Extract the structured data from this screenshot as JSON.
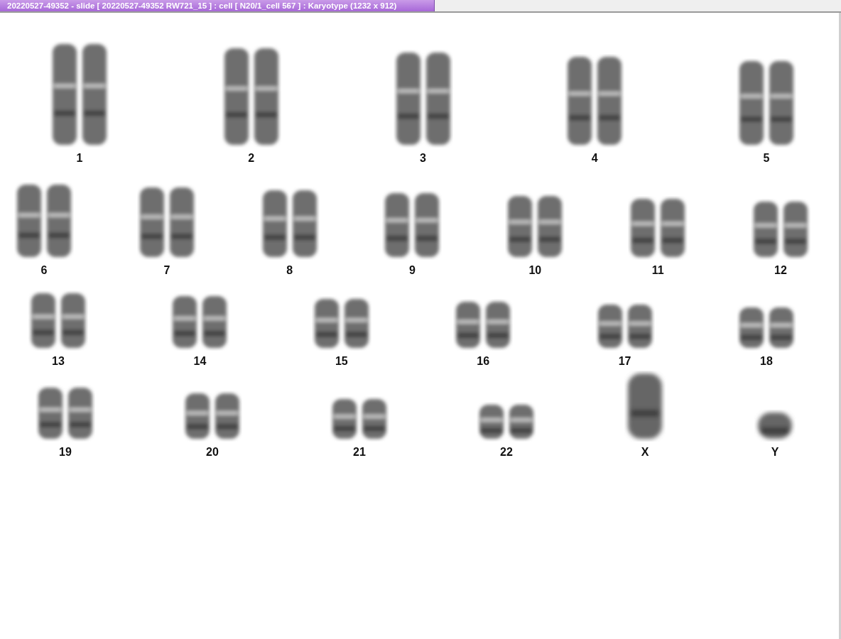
{
  "window": {
    "title": "20220527-49352 - slide [ 20220527-49352 RW721_15 ] : cell [ N20/1_cell 567 ] : Karyotype  (1232 x 912)"
  },
  "karyotype": {
    "rows": [
      [
        {
          "label": "1",
          "kind": "pair"
        },
        {
          "label": "2",
          "kind": "pair"
        },
        {
          "label": "3",
          "kind": "pair"
        },
        {
          "label": "4",
          "kind": "pair"
        },
        {
          "label": "5",
          "kind": "pair"
        }
      ],
      [
        {
          "label": "6",
          "kind": "pair"
        },
        {
          "label": "7",
          "kind": "pair"
        },
        {
          "label": "8",
          "kind": "pair"
        },
        {
          "label": "9",
          "kind": "pair"
        },
        {
          "label": "10",
          "kind": "pair"
        },
        {
          "label": "11",
          "kind": "pair"
        },
        {
          "label": "12",
          "kind": "pair"
        }
      ],
      [
        {
          "label": "13",
          "kind": "pair"
        },
        {
          "label": "14",
          "kind": "pair"
        },
        {
          "label": "15",
          "kind": "pair"
        },
        {
          "label": "16",
          "kind": "pair"
        },
        {
          "label": "17",
          "kind": "pair"
        },
        {
          "label": "18",
          "kind": "pair"
        }
      ],
      [
        {
          "label": "19",
          "kind": "pair"
        },
        {
          "label": "20",
          "kind": "pair"
        },
        {
          "label": "21",
          "kind": "pair"
        },
        {
          "label": "22",
          "kind": "pair"
        },
        {
          "label": "X",
          "kind": "single"
        },
        {
          "label": "Y",
          "kind": "single"
        }
      ]
    ]
  }
}
